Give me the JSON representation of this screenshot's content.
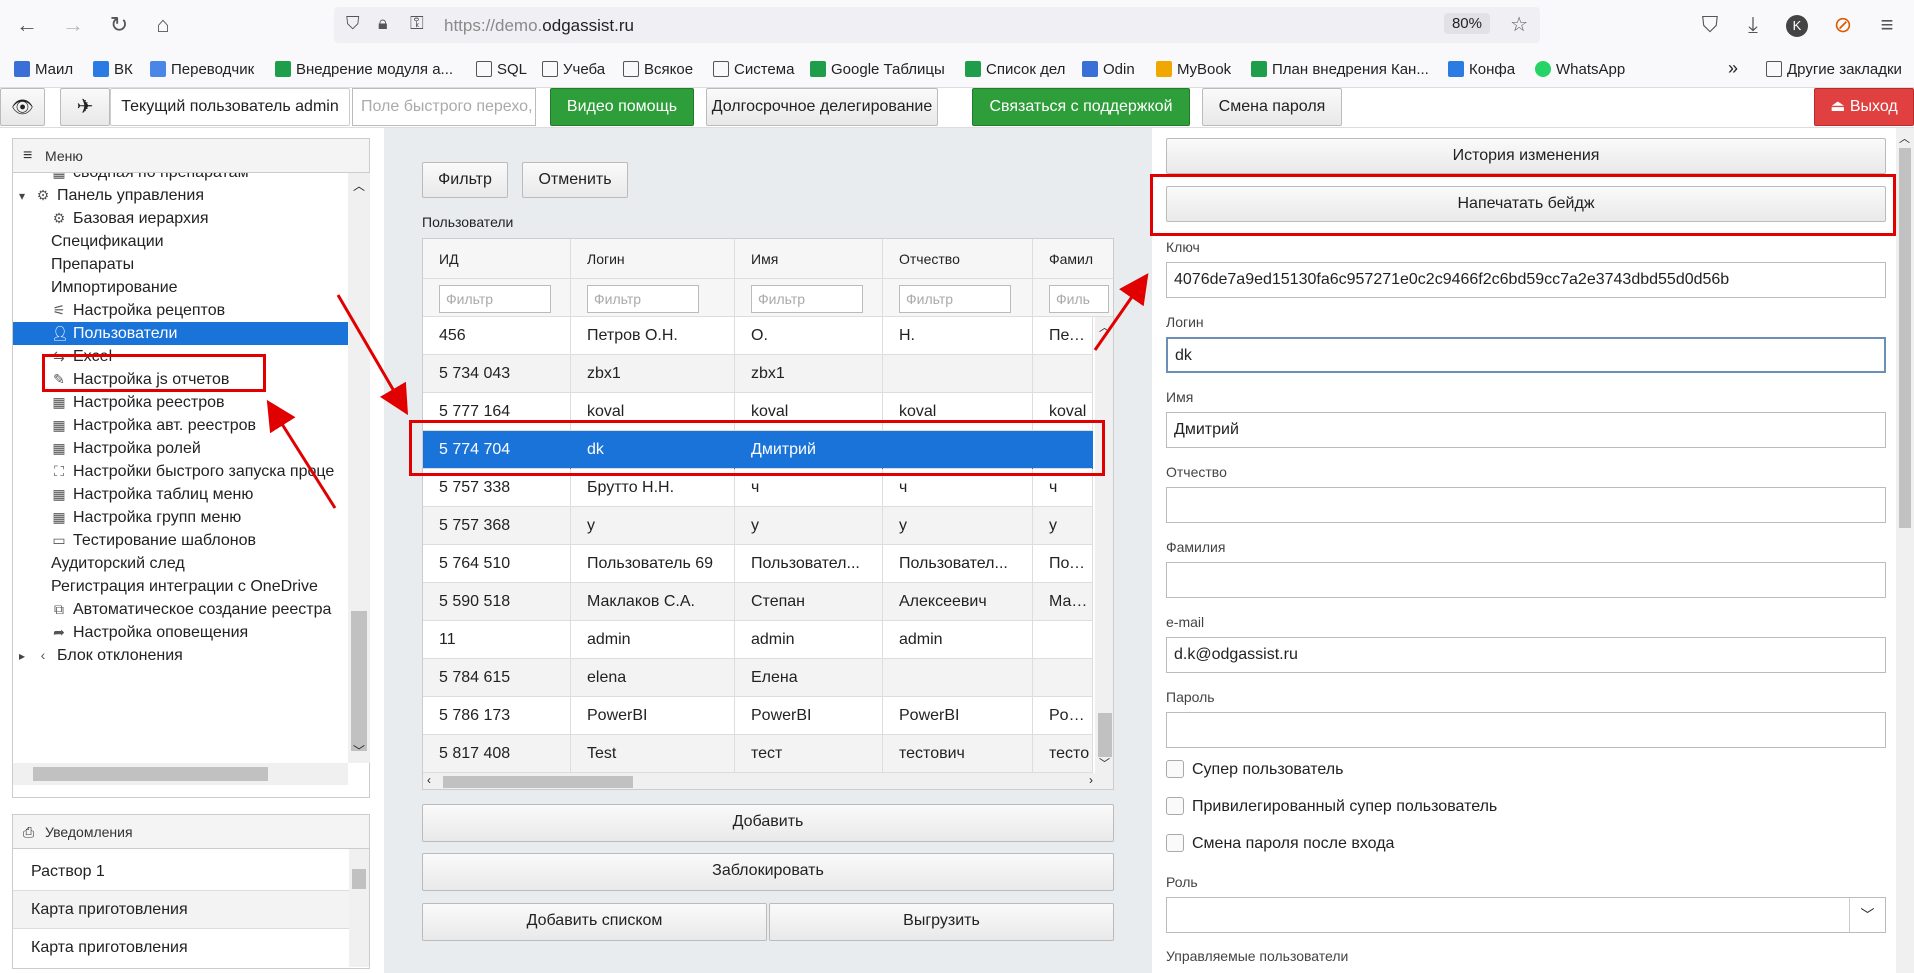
{
  "browser": {
    "url_prefix": "https://demo.",
    "url_domain": "odgassist.ru",
    "zoom": "80%",
    "profile_initial": "K",
    "bookmarks": [
      "Маил",
      "ВК",
      "Переводчик",
      "Внедрение модуля а...",
      "SQL",
      "Учеба",
      "Всякое",
      "Система",
      "Google Таблицы",
      "Список дел",
      "Odin",
      "MyBook",
      "План внедрения Кан...",
      "Конфа",
      "WhatsApp"
    ],
    "other_bookmarks": "Другие закладки"
  },
  "toolbar": {
    "current_user": "Текущий пользователь admin",
    "quick_placeholder": "Поле быстрого перехо,",
    "video_help": "Видео помощь",
    "delegation": "Долгосрочное делегирование",
    "support": "Связаться с поддержкой",
    "change_password": "Смена пароля",
    "logout": "Выход"
  },
  "menu": {
    "title": "Меню",
    "items": [
      {
        "label": "сводная по препаратам",
        "icon": "table-icon",
        "indent": 1
      },
      {
        "label": "Панель управления",
        "icon": "settings-icon",
        "indent": 0
      },
      {
        "label": "Базовая иерархия",
        "icon": "settings-icon",
        "indent": 1
      },
      {
        "label": "Спецификации",
        "icon": "",
        "indent": 1
      },
      {
        "label": "Препараты",
        "icon": "",
        "indent": 1
      },
      {
        "label": "Импортирование",
        "icon": "",
        "indent": 1
      },
      {
        "label": "Настройка рецептов",
        "icon": "sliders-icon",
        "indent": 1
      },
      {
        "label": "Пользователи",
        "icon": "user-icon",
        "indent": 1,
        "selected": true
      },
      {
        "label": "Excel",
        "icon": "arrows-icon",
        "indent": 1
      },
      {
        "label": "Настройка js отчетов",
        "icon": "paperclip-icon",
        "indent": 1
      },
      {
        "label": "Настройка реестров",
        "icon": "table-icon",
        "indent": 1
      },
      {
        "label": "Настройка авт. реестров",
        "icon": "table-icon",
        "indent": 1
      },
      {
        "label": "Настройка ролей",
        "icon": "table-icon",
        "indent": 1
      },
      {
        "label": "Настройки быстрого запуска проце",
        "icon": "frame-icon",
        "indent": 1
      },
      {
        "label": "Настройка таблиц меню",
        "icon": "table-icon",
        "indent": 1
      },
      {
        "label": "Настройка групп меню",
        "icon": "table-icon",
        "indent": 1
      },
      {
        "label": "Тестирование шаблонов",
        "icon": "monitor-icon",
        "indent": 1
      },
      {
        "label": "Аудиторский след",
        "icon": "",
        "indent": 1
      },
      {
        "label": "Регистрация интеграции с OneDrive",
        "icon": "",
        "indent": 1
      },
      {
        "label": "Автоматическое создание реестра",
        "icon": "copy-icon",
        "indent": 1
      },
      {
        "label": "Настройка оповещения",
        "icon": "share-icon",
        "indent": 1
      },
      {
        "label": "Блок отклонения",
        "icon": "chevron-left-icon",
        "indent": 0
      }
    ]
  },
  "notifications": {
    "title": "Уведомления",
    "items": [
      "Раствор 1",
      "Карта приготовления",
      "Карта приготовления"
    ]
  },
  "middle": {
    "filter": "Фильтр",
    "cancel": "Отменить",
    "section": "Пользователи",
    "columns": [
      "ИД",
      "Логин",
      "Имя",
      "Отчество",
      "Фамил"
    ],
    "filter_placeholder": "Фильтр",
    "filter_placeholder_cut": "Филь",
    "rows": [
      [
        "456",
        "Петров О.Н.",
        "О.",
        "Н.",
        "Петро"
      ],
      [
        "5 734 043",
        "zbx1",
        "zbx1",
        "",
        ""
      ],
      [
        "5 777 164",
        "koval",
        "koval",
        "koval",
        "koval"
      ],
      [
        "5 774 704",
        "dk",
        "Дмитрий",
        "",
        ""
      ],
      [
        "5 757 338",
        "Брутто Н.Н.",
        "ч",
        "ч",
        "ч"
      ],
      [
        "5 757 368",
        "у",
        "у",
        "у",
        "у"
      ],
      [
        "5 764 510",
        "Пользователь 69",
        "Пользовател...",
        "Пользовател...",
        "Польз"
      ],
      [
        "5 590 518",
        "Маклаков С.А.",
        "Степан",
        "Алексеевич",
        "Макла"
      ],
      [
        "11",
        "admin",
        "admin",
        "admin",
        ""
      ],
      [
        "5 784 615",
        "elena",
        "Елена",
        "",
        ""
      ],
      [
        "5 786 173",
        "PowerBI",
        "PowerBI",
        "PowerBI",
        "Power"
      ],
      [
        "5 817 408",
        "Test",
        "тест",
        "тестович",
        "тесто"
      ]
    ],
    "selected_row": 3,
    "add": "Добавить",
    "block": "Заблокировать",
    "add_list": "Добавить списком",
    "export": "Выгрузить"
  },
  "right": {
    "history": "История изменения",
    "print_badge": "Напечатать бейдж",
    "key_label": "Ключ",
    "key_value": "4076de7a9ed15130fa6c957271e0c2c9466f2c6bd59cc7a2e3743dbd55d0d56b",
    "login_label": "Логин",
    "login_value": "dk",
    "name_label": "Имя",
    "name_value": "Дмитрий",
    "patronymic_label": "Отчество",
    "patronymic_value": "",
    "surname_label": "Фамилия",
    "surname_value": "",
    "email_label": "e-mail",
    "email_value": "d.k@odgassist.ru",
    "password_label": "Пароль",
    "password_value": "",
    "super_user": "Супер пользователь",
    "priv_super_user": "Привилегированный супер пользователь",
    "change_pw_after_login": "Смена пароля после входа",
    "role_label": "Роль",
    "role_value": "",
    "managed_users": "Управляемые пользователи"
  }
}
